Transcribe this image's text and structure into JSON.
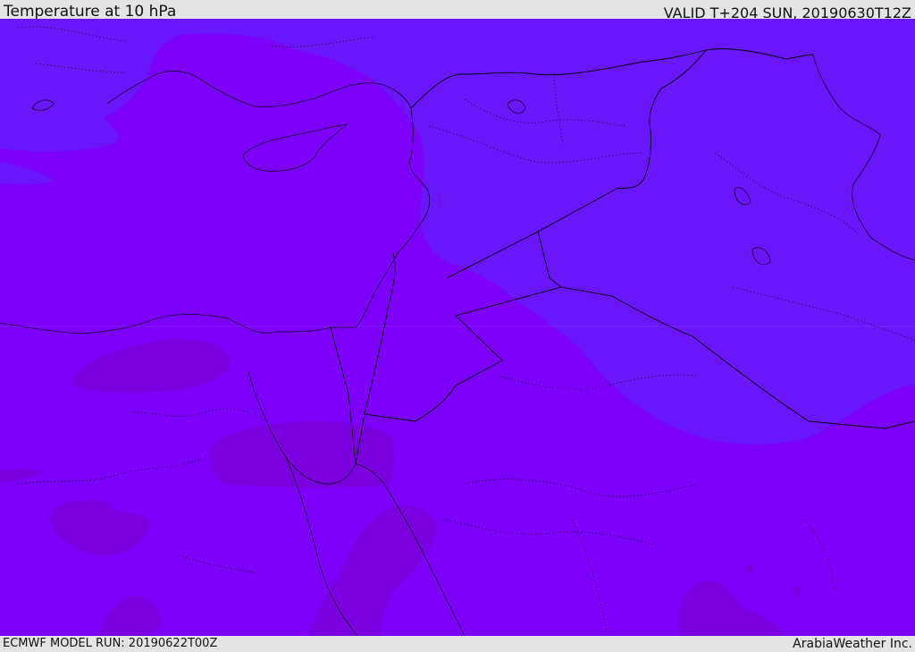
{
  "header": {
    "title": "Temperature at 10 hPa",
    "valid": "VALID T+204 SUN, 20190630T12Z"
  },
  "footer": {
    "model_run": "ECMWF MODEL RUN: 20190622T00Z",
    "credit": "ArabiaWeather Inc."
  },
  "map": {
    "colors": {
      "warm_field": "#7d00fb",
      "cool_field": "#6a16fb",
      "warmest_field": "#7b00df",
      "border_line": "#000000"
    }
  }
}
